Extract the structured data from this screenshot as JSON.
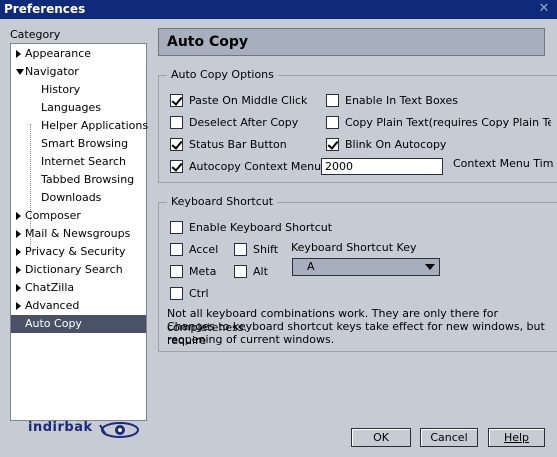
{
  "window": {
    "title": "Preferences",
    "close_glyph": "✕"
  },
  "sidebar": {
    "label": "Category",
    "items": [
      {
        "label": "Appearance",
        "level": 0,
        "twisty": "closed"
      },
      {
        "label": "Navigator",
        "level": 0,
        "twisty": "open"
      },
      {
        "label": "History",
        "level": 1
      },
      {
        "label": "Languages",
        "level": 1
      },
      {
        "label": "Helper Applications",
        "level": 1
      },
      {
        "label": "Smart Browsing",
        "level": 1
      },
      {
        "label": "Internet Search",
        "level": 1
      },
      {
        "label": "Tabbed Browsing",
        "level": 1
      },
      {
        "label": "Downloads",
        "level": 1
      },
      {
        "label": "Composer",
        "level": 0,
        "twisty": "closed"
      },
      {
        "label": "Mail & Newsgroups",
        "level": 0,
        "twisty": "closed"
      },
      {
        "label": "Privacy & Security",
        "level": 0,
        "twisty": "closed"
      },
      {
        "label": "Dictionary Search",
        "level": 0,
        "twisty": "closed"
      },
      {
        "label": "ChatZilla",
        "level": 0,
        "twisty": "closed"
      },
      {
        "label": "Advanced",
        "level": 0,
        "twisty": "closed"
      },
      {
        "label": "Auto Copy",
        "level": 0,
        "selected": true
      }
    ]
  },
  "main": {
    "title": "Auto Copy",
    "options_group": {
      "legend": "Auto Copy Options",
      "paste_on_middle_click": {
        "label": "Paste On Middle Click",
        "checked": true
      },
      "deselect_after_copy": {
        "label": "Deselect After Copy",
        "checked": false
      },
      "status_bar_button": {
        "label": "Status Bar Button",
        "checked": true
      },
      "autocopy_context_menu": {
        "label": "Autocopy Context Menu",
        "checked": true
      },
      "enable_in_text_boxes": {
        "label": "Enable In Text Boxes",
        "checked": false
      },
      "copy_plain_text": {
        "label": "Copy Plain Text(requires Copy Plain Text e",
        "checked": false
      },
      "blink_on_autocopy": {
        "label": "Blink On Autocopy",
        "checked": true
      },
      "timeout_value": "2000",
      "timeout_label": "Context Menu Timec"
    },
    "shortcut_group": {
      "legend": "Keyboard Shortcut",
      "enable_shortcut": {
        "label": "Enable Keyboard Shortcut",
        "checked": false
      },
      "accel": {
        "label": "Accel",
        "checked": false
      },
      "shift": {
        "label": "Shift",
        "checked": false
      },
      "meta": {
        "label": "Meta",
        "checked": false
      },
      "alt": {
        "label": "Alt",
        "checked": false
      },
      "ctrl": {
        "label": "Ctrl",
        "checked": false
      },
      "key_label": "Keyboard Shortcut Key",
      "key_value": "A",
      "note_line1": "Not all keyboard combinations work. They are only there for completeness.",
      "note_line2": "Changes to keyboard shortcut keys take effect for new windows, but require",
      "note_line3": "reopening of current windows."
    }
  },
  "footer": {
    "ok": "OK",
    "cancel": "Cancel",
    "help": "Help",
    "logo_text": "indirbak"
  }
}
